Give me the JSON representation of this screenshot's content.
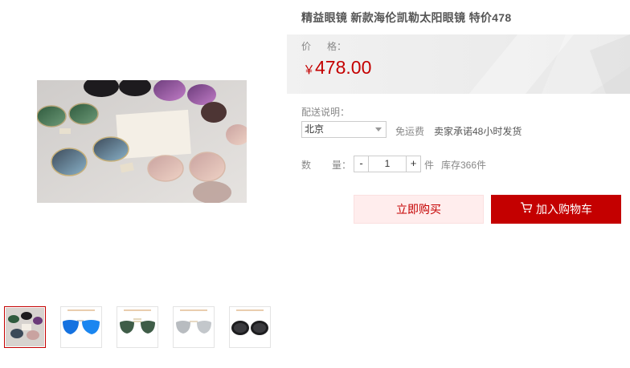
{
  "product": {
    "title": "精益眼镜 新款海伦凯勒太阳眼镜 特价478",
    "price_label_a": "价",
    "price_label_b": "格：",
    "currency": "￥",
    "price": "478.00"
  },
  "shipping": {
    "label": "配送说明：",
    "selected_city": "北京",
    "free_shipping": "免运费",
    "promise": "卖家承诺48小时发货"
  },
  "quantity": {
    "label_a": "数",
    "label_b": "量：",
    "minus": "-",
    "value": "1",
    "plus": "+",
    "unit": "件",
    "stock": "库存366件"
  },
  "actions": {
    "buy_now": "立即购买",
    "add_to_cart": "加入购物车"
  },
  "icons": {
    "cart": "shopping-cart-icon",
    "dropdown": "chevron-down-icon"
  },
  "colors": {
    "accent": "#c40000",
    "buy_now_bg": "#ffeded"
  },
  "thumbnails": [
    {
      "name": "thumb-group-photo",
      "active": true
    },
    {
      "name": "thumb-blue-aviator",
      "active": false
    },
    {
      "name": "thumb-green-aviator",
      "active": false
    },
    {
      "name": "thumb-silver-aviator",
      "active": false
    },
    {
      "name": "thumb-black-round",
      "active": false
    }
  ]
}
